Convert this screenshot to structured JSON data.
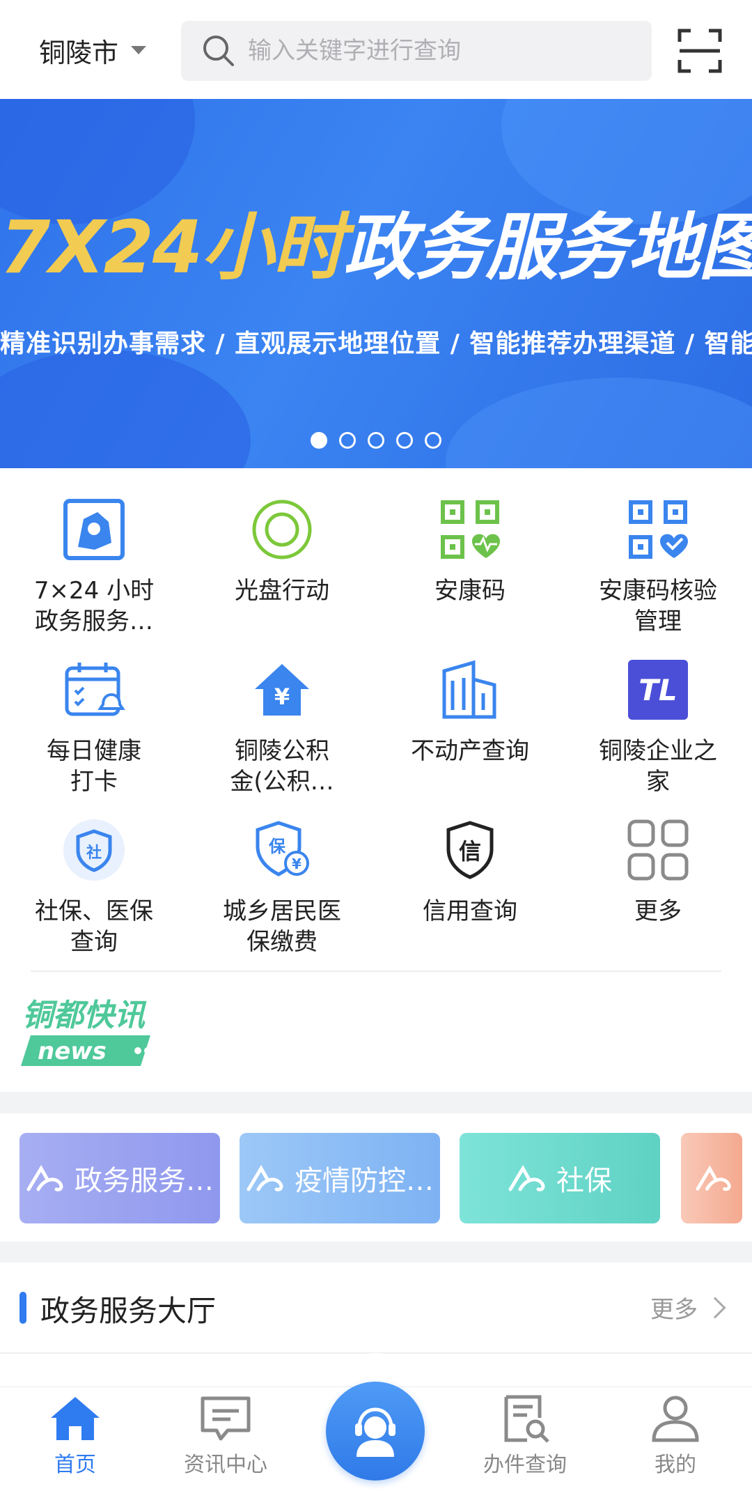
{
  "header": {
    "city": "铜陵市",
    "search_placeholder": "输入关键字进行查询"
  },
  "banner": {
    "headline_highlight": "7X24小时",
    "headline_rest": "政务服务地图！上线啦！",
    "subline": "精准识别办事需求 / 直观展示地理位置 / 智能推荐办理渠道 / 智能导航办理路线",
    "dot_count": 5,
    "active_dot": 0
  },
  "services": [
    {
      "label": "7×24 小时\n政务服务…",
      "icon": "map-pin-icon"
    },
    {
      "label": "光盘行动",
      "icon": "disc-icon"
    },
    {
      "label": "安康码",
      "icon": "qr-health-icon"
    },
    {
      "label": "安康码核验\n管理",
      "icon": "qr-check-icon"
    },
    {
      "label": "每日健康\n打卡",
      "icon": "calendar-bell-icon"
    },
    {
      "label": "铜陵公积\n金(公积…",
      "icon": "house-yuan-icon"
    },
    {
      "label": "不动产查询",
      "icon": "building-icon"
    },
    {
      "label": "铜陵企业之\n家",
      "icon": "tl-logo-icon"
    },
    {
      "label": "社保、医保\n查询",
      "icon": "social-shield-icon"
    },
    {
      "label": "城乡居民医\n保缴费",
      "icon": "insurance-shield-icon"
    },
    {
      "label": "信用查询",
      "icon": "credit-shield-icon"
    },
    {
      "label": "更多",
      "icon": "grid-more-icon"
    }
  ],
  "news_logo": {
    "cn": "铜都快讯",
    "en": "news"
  },
  "categories": [
    {
      "label": "政务服务…",
      "color_from": "#a7aef2",
      "color_to": "#8f98ee"
    },
    {
      "label": "疫情防控…",
      "color_from": "#9cc8f7",
      "color_to": "#7eb2f3"
    },
    {
      "label": "社保",
      "color_from": "#7ee3d9",
      "color_to": "#5fd2c4"
    },
    {
      "label": "",
      "color_from": "#f9c9b8",
      "color_to": "#f4a98f"
    }
  ],
  "hall": {
    "title": "政务服务大厅",
    "more": "更多"
  },
  "bottom_nav": [
    {
      "label": "首页",
      "icon": "home-icon",
      "active": true
    },
    {
      "label": "资讯中心",
      "icon": "message-icon",
      "active": false
    },
    {
      "label": "",
      "icon": "customer-service-icon",
      "active": false
    },
    {
      "label": "办件查询",
      "icon": "doc-search-icon",
      "active": false
    },
    {
      "label": "我的",
      "icon": "user-icon",
      "active": false
    }
  ],
  "colors": {
    "primary": "#2f7bf0",
    "green": "#6cc24a",
    "indigo": "#4b4fd8"
  }
}
